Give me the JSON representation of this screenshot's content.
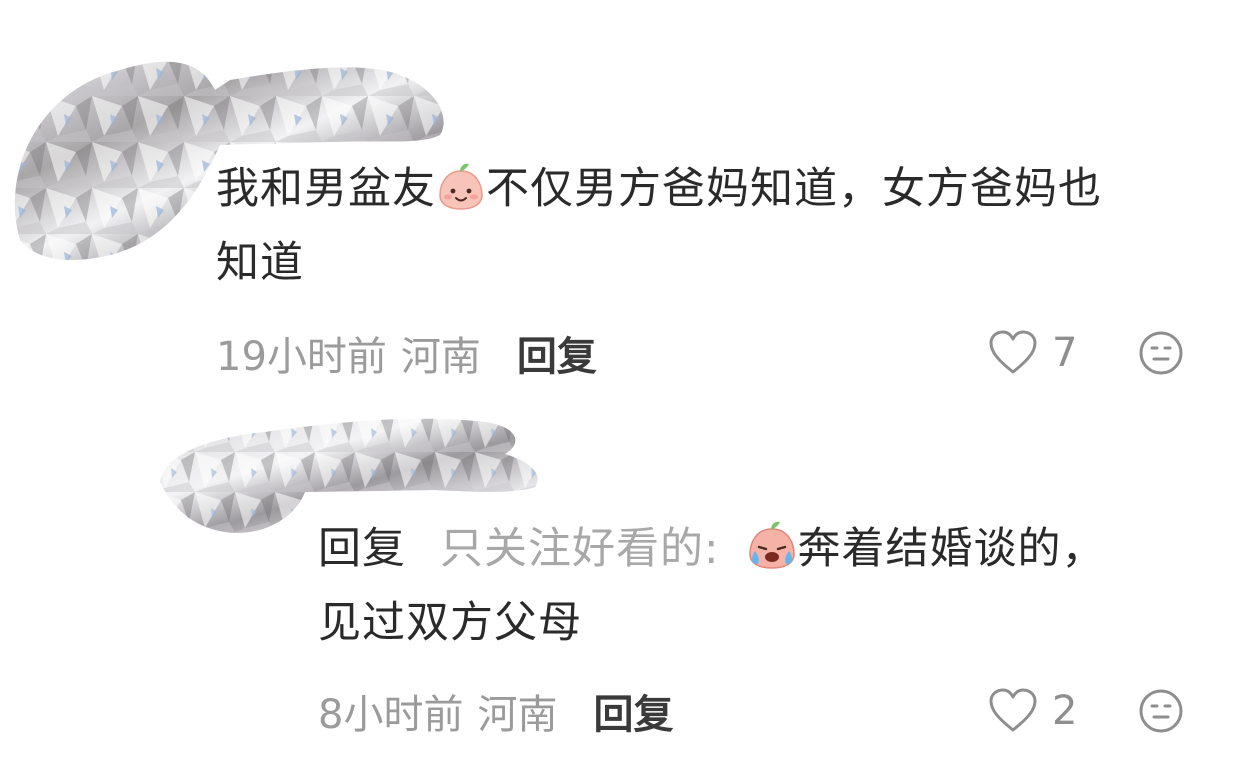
{
  "comment": {
    "text_before": "我和男盆友",
    "emoji": "smile-emoji",
    "text_line1_after": "不仅男方爸妈知道，女方爸妈也",
    "text_line2": "知道",
    "time": "19小时前",
    "location": "河南",
    "reply_label": "回复",
    "like_count": "7"
  },
  "reply": {
    "prefix": "回复",
    "target": "只关注好看的:",
    "emoji": "crying-emoji",
    "text_line1_after": "奔着结婚谈的，",
    "text_line2": "见过双方父母",
    "time": "8小时前",
    "location": "河南",
    "reply_label": "回复",
    "like_count": "2"
  },
  "colors": {
    "text": "#2a2a2a",
    "meta": "#9b9b9b",
    "icon": "#8e8e8e"
  }
}
